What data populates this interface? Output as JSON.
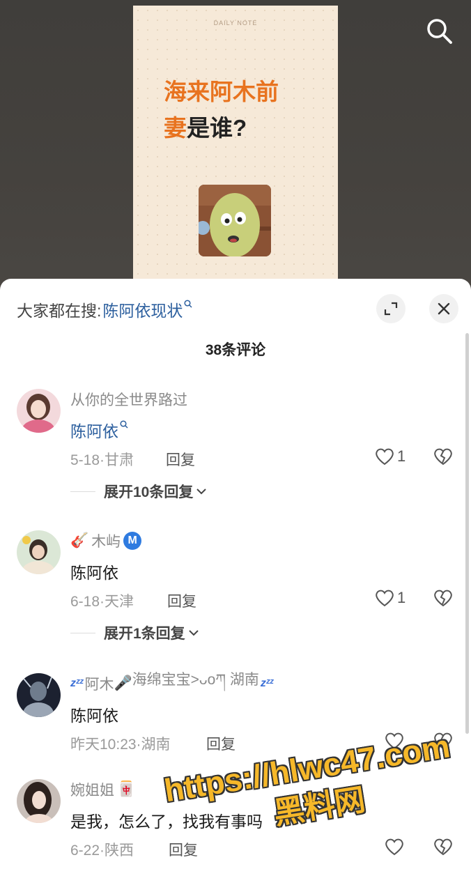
{
  "video": {
    "note_label": "DAILY NOTE",
    "title_orange_1": "海来阿木前",
    "title_orange_2": "妻",
    "title_black": "是谁?"
  },
  "sheet": {
    "search_prefix": "大家都在搜:",
    "search_term": "陈阿依现状",
    "comment_count": "38条评论"
  },
  "comments": [
    {
      "username": "从你的全世界路过",
      "text": "陈阿依",
      "date_location": "5-18·甘肃",
      "reply_label": "回复",
      "likes": "1",
      "expand_label": "展开10条回复"
    },
    {
      "username_emoji": "🎸",
      "username": "木屿",
      "badge": "M",
      "text": "陈阿依",
      "date_location": "6-18·天津",
      "reply_label": "回复",
      "likes": "1",
      "expand_label": "展开1条回复"
    },
    {
      "zzz": "zᶻᶻ",
      "username_a": "阿木",
      "mic_emoji": "🎤",
      "username_b": "海绵宝宝>ᴗoཀ 湖南",
      "text": "陈阿依",
      "date_location": "昨天10:23·湖南",
      "reply_label": "回复"
    },
    {
      "username": "婉姐姐",
      "username_emoji": "🀄",
      "text": "是我，怎么了，找我有事吗",
      "date_location": "6-22·陕西",
      "reply_label": "回复"
    }
  ],
  "watermark": {
    "line1": "https://hlwc47.com",
    "line2": "黑料网"
  },
  "colors": {
    "link_blue": "#2c5f9e",
    "title_orange": "#e8731f",
    "watermark_yellow": "#f6b829"
  }
}
